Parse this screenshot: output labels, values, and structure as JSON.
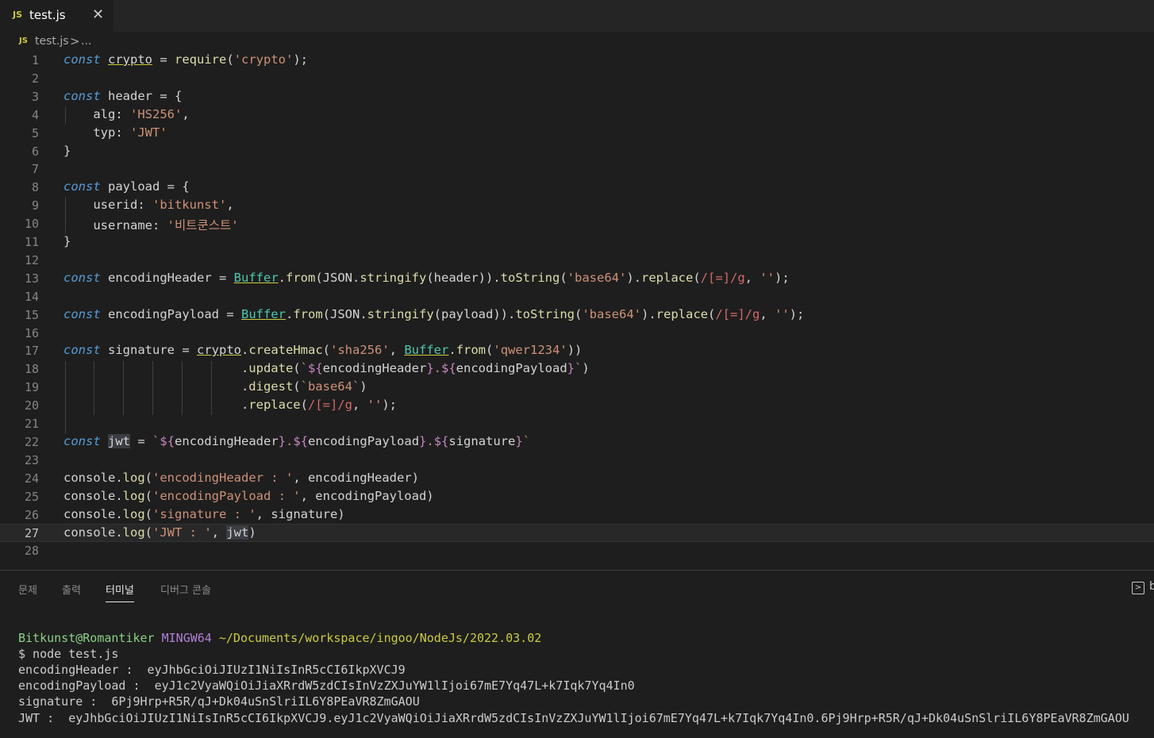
{
  "tab": {
    "icon": "JS",
    "filename": "test.js",
    "close_icon": "close-icon"
  },
  "breadcrumb": {
    "icon": "JS",
    "file": "test.js",
    "separator": ">",
    "more": "..."
  },
  "panel": {
    "tabs": [
      "문제",
      "출력",
      "터미널",
      "디버그 콘솔"
    ],
    "active_tab": "터미널",
    "right_icon": "terminal-split-icon",
    "right_label": "b"
  },
  "terminal": {
    "user": "Bitkunst@Romantiker",
    "host": "MINGW64",
    "path": "~/Documents/workspace/ingoo/NodeJs/2022.03.02",
    "command": "$ node test.js",
    "output": [
      "encodingHeader :  eyJhbGciOiJIUzI1NiIsInR5cCI6IkpXVCJ9",
      "encodingPayload :  eyJ1c2VyaWQiOiJiaXRrdW5zdCIsInVzZXJuYW1lIjoi67mE7Yq47L+k7Iqk7Yq4In0",
      "signature :  6Pj9Hrp+R5R/qJ+Dk04uSnSlriIL6Y8PEaVR8ZmGAOU",
      "JWT :  eyJhbGciOiJIUzI1NiIsInR5cCI6IkpXVCJ9.eyJ1c2VyaWQiOiJiaXRrdW5zdCIsInVzZXJuYW1lIjoi67mE7Yq47L+k7Iqk7Yq4In0.6Pj9Hrp+R5R/qJ+Dk04uSnSlriIL6Y8PEaVR8ZmGAOU"
    ]
  },
  "editor": {
    "active_line": 27,
    "lines": [
      "const crypto = require('crypto');",
      "",
      "const header = {",
      "    alg: 'HS256',",
      "    typ: 'JWT'",
      "}",
      "",
      "const payload = {",
      "    userid: 'bitkunst',",
      "    username: '비트쿤스트'",
      "}",
      "",
      "const encodingHeader = Buffer.from(JSON.stringify(header)).toString('base64').replace(/[=]/g, '');",
      "",
      "const encodingPayload = Buffer.from(JSON.stringify(payload)).toString('base64').replace(/[=]/g, '');",
      "",
      "const signature = crypto.createHmac('sha256', Buffer.from('qwer1234'))",
      "                        .update(`${encodingHeader}.${encodingPayload}`)",
      "                        .digest(`base64`)",
      "                        .replace(/[=]/g, '');",
      "",
      "const jwt = `${encodingHeader}.${encodingPayload}.${signature}`",
      "",
      "console.log('encodingHeader : ', encodingHeader)",
      "console.log('encodingPayload : ', encodingPayload)",
      "console.log('signature : ', signature)",
      "console.log('JWT : ', jwt)",
      ""
    ]
  }
}
